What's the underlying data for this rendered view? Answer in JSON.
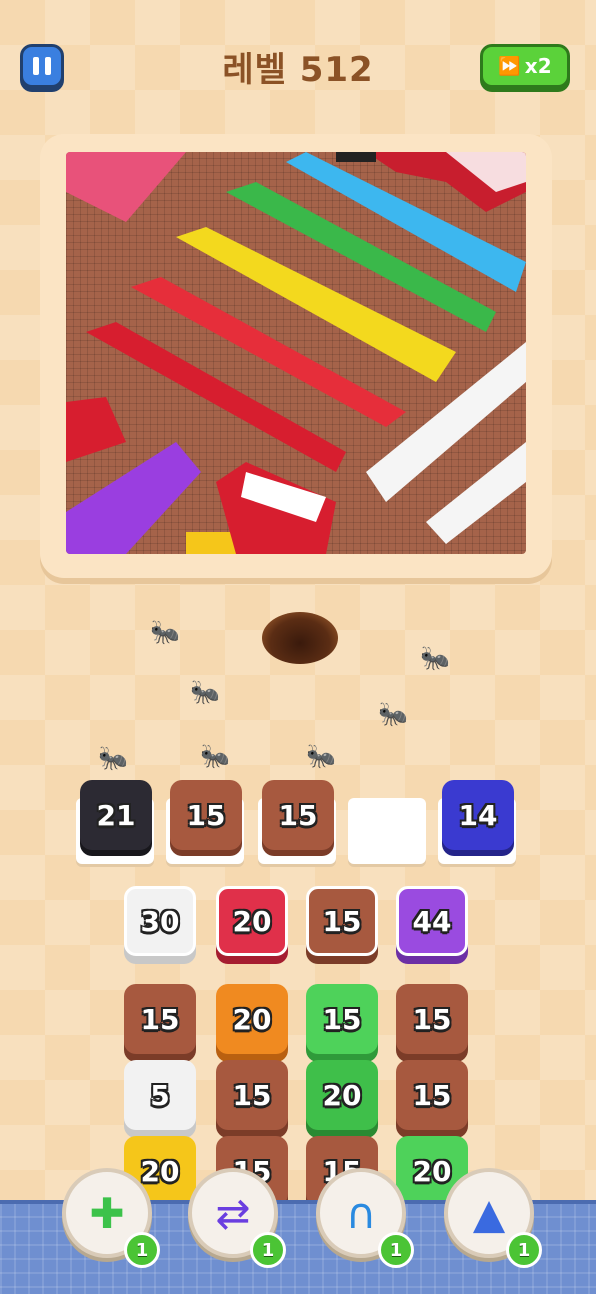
{
  "header": {
    "level_title": "레벨 512",
    "speed_label": "x2"
  },
  "colors": {
    "black": "#2c2a33",
    "brown": "#a7593f",
    "blue": "#3a3ad0",
    "white": "#f2f2f2",
    "red": "#e0304a",
    "purple": "#9a4be0",
    "orange": "#f08a20",
    "green": "#4ed25a",
    "yellow": "#f5c61a",
    "badge_green": "#4bc435"
  },
  "slots": [
    {
      "value": "21",
      "color": "black"
    },
    {
      "value": "15",
      "color": "brown"
    },
    {
      "value": "15",
      "color": "brown"
    },
    {
      "value": "",
      "color": "empty"
    },
    {
      "value": "14",
      "color": "blue"
    }
  ],
  "grid": {
    "rows": [
      [
        {
          "value": "30",
          "color": "white"
        },
        {
          "value": "20",
          "color": "red"
        },
        {
          "value": "15",
          "color": "brown"
        },
        {
          "value": "44",
          "color": "purple"
        }
      ],
      [
        {
          "value": "15",
          "color": "brown"
        },
        {
          "value": "20",
          "color": "orange"
        },
        {
          "value": "15",
          "color": "green"
        },
        {
          "value": "15",
          "color": "brown"
        }
      ],
      [
        {
          "value": "5",
          "color": "white"
        },
        {
          "value": "15",
          "color": "brown"
        },
        {
          "value": "20",
          "color": "green"
        },
        {
          "value": "15",
          "color": "brown"
        }
      ],
      [
        {
          "value": "20",
          "color": "yellow"
        },
        {
          "value": "15",
          "color": "brown"
        },
        {
          "value": "15",
          "color": "brown"
        },
        {
          "value": "20",
          "color": "green"
        }
      ]
    ]
  },
  "boosters": [
    {
      "name": "add-tray-icon",
      "count": "1"
    },
    {
      "name": "shuffle-icon",
      "count": "1"
    },
    {
      "name": "claw-icon",
      "count": "1"
    },
    {
      "name": "vacuum-icon",
      "count": "1"
    }
  ]
}
